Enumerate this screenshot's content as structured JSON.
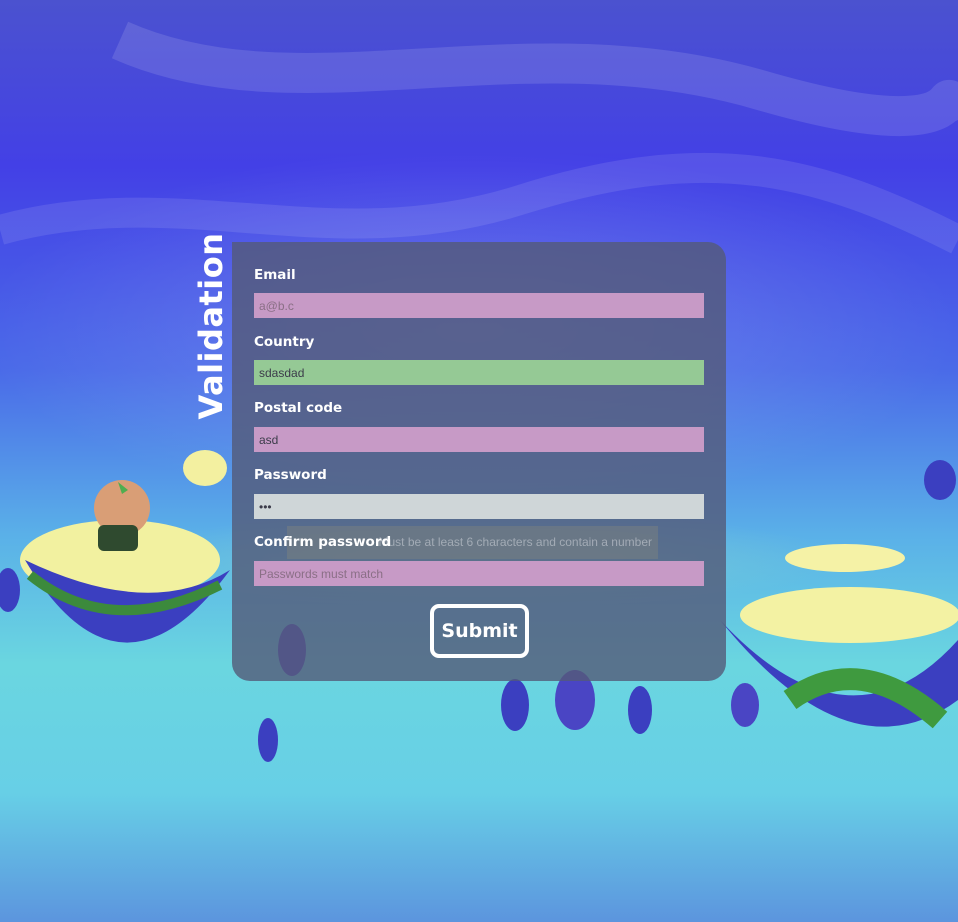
{
  "form": {
    "title": "Validation",
    "fields": [
      {
        "label": "Email",
        "value": "",
        "placeholder": "a@b.c",
        "state": "invalid"
      },
      {
        "label": "Country",
        "value": "sdasdad",
        "placeholder": "",
        "state": "valid"
      },
      {
        "label": "Postal code",
        "value": "asd",
        "placeholder": "",
        "state": "invalid"
      },
      {
        "label": "Password",
        "value": "•••",
        "placeholder": "",
        "state": "focused"
      },
      {
        "label": "Confirm password",
        "value": "",
        "placeholder": "Passwords must match",
        "state": "invalid"
      }
    ],
    "password_hint": "Must be at least 6 characters and contain a number",
    "submit_label": "Submit"
  },
  "colors": {
    "invalid": "#c79ac6",
    "valid": "#95c995",
    "focused": "#cfd6d8",
    "panel": "#545a78"
  }
}
